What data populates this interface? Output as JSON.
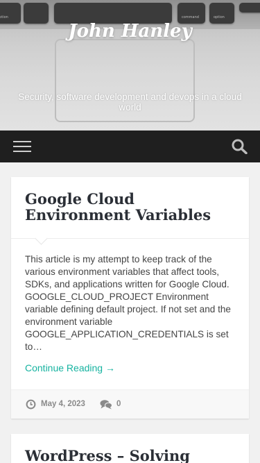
{
  "header": {
    "site_title": "John Hanley",
    "tagline": "Security, software development and devops in a cloud world",
    "keyboard_keys": [
      "option",
      "command",
      "command",
      "option"
    ]
  },
  "nav": {
    "menu_icon": "hamburger-menu-icon",
    "search_icon": "search-icon"
  },
  "posts": [
    {
      "title": "Google Cloud Environment Variables",
      "excerpt": "This article is my attempt to keep track of the various environment variables that affect tools, SDKs, and applications written for Google Cloud. GOOGLE_CLOUD_PROJECT Environment variable defining default project. If not set and the environment variable GOOGLE_APPLICATION_CREDENTIALS is set to…",
      "read_more": "Continue Reading →",
      "date": "May 4, 2023",
      "comments": "0"
    },
    {
      "title": "WordPress – Solving"
    }
  ],
  "colors": {
    "accent": "#16b3a0",
    "navbar": "#1f1f1f",
    "title": "#2b2f36"
  }
}
